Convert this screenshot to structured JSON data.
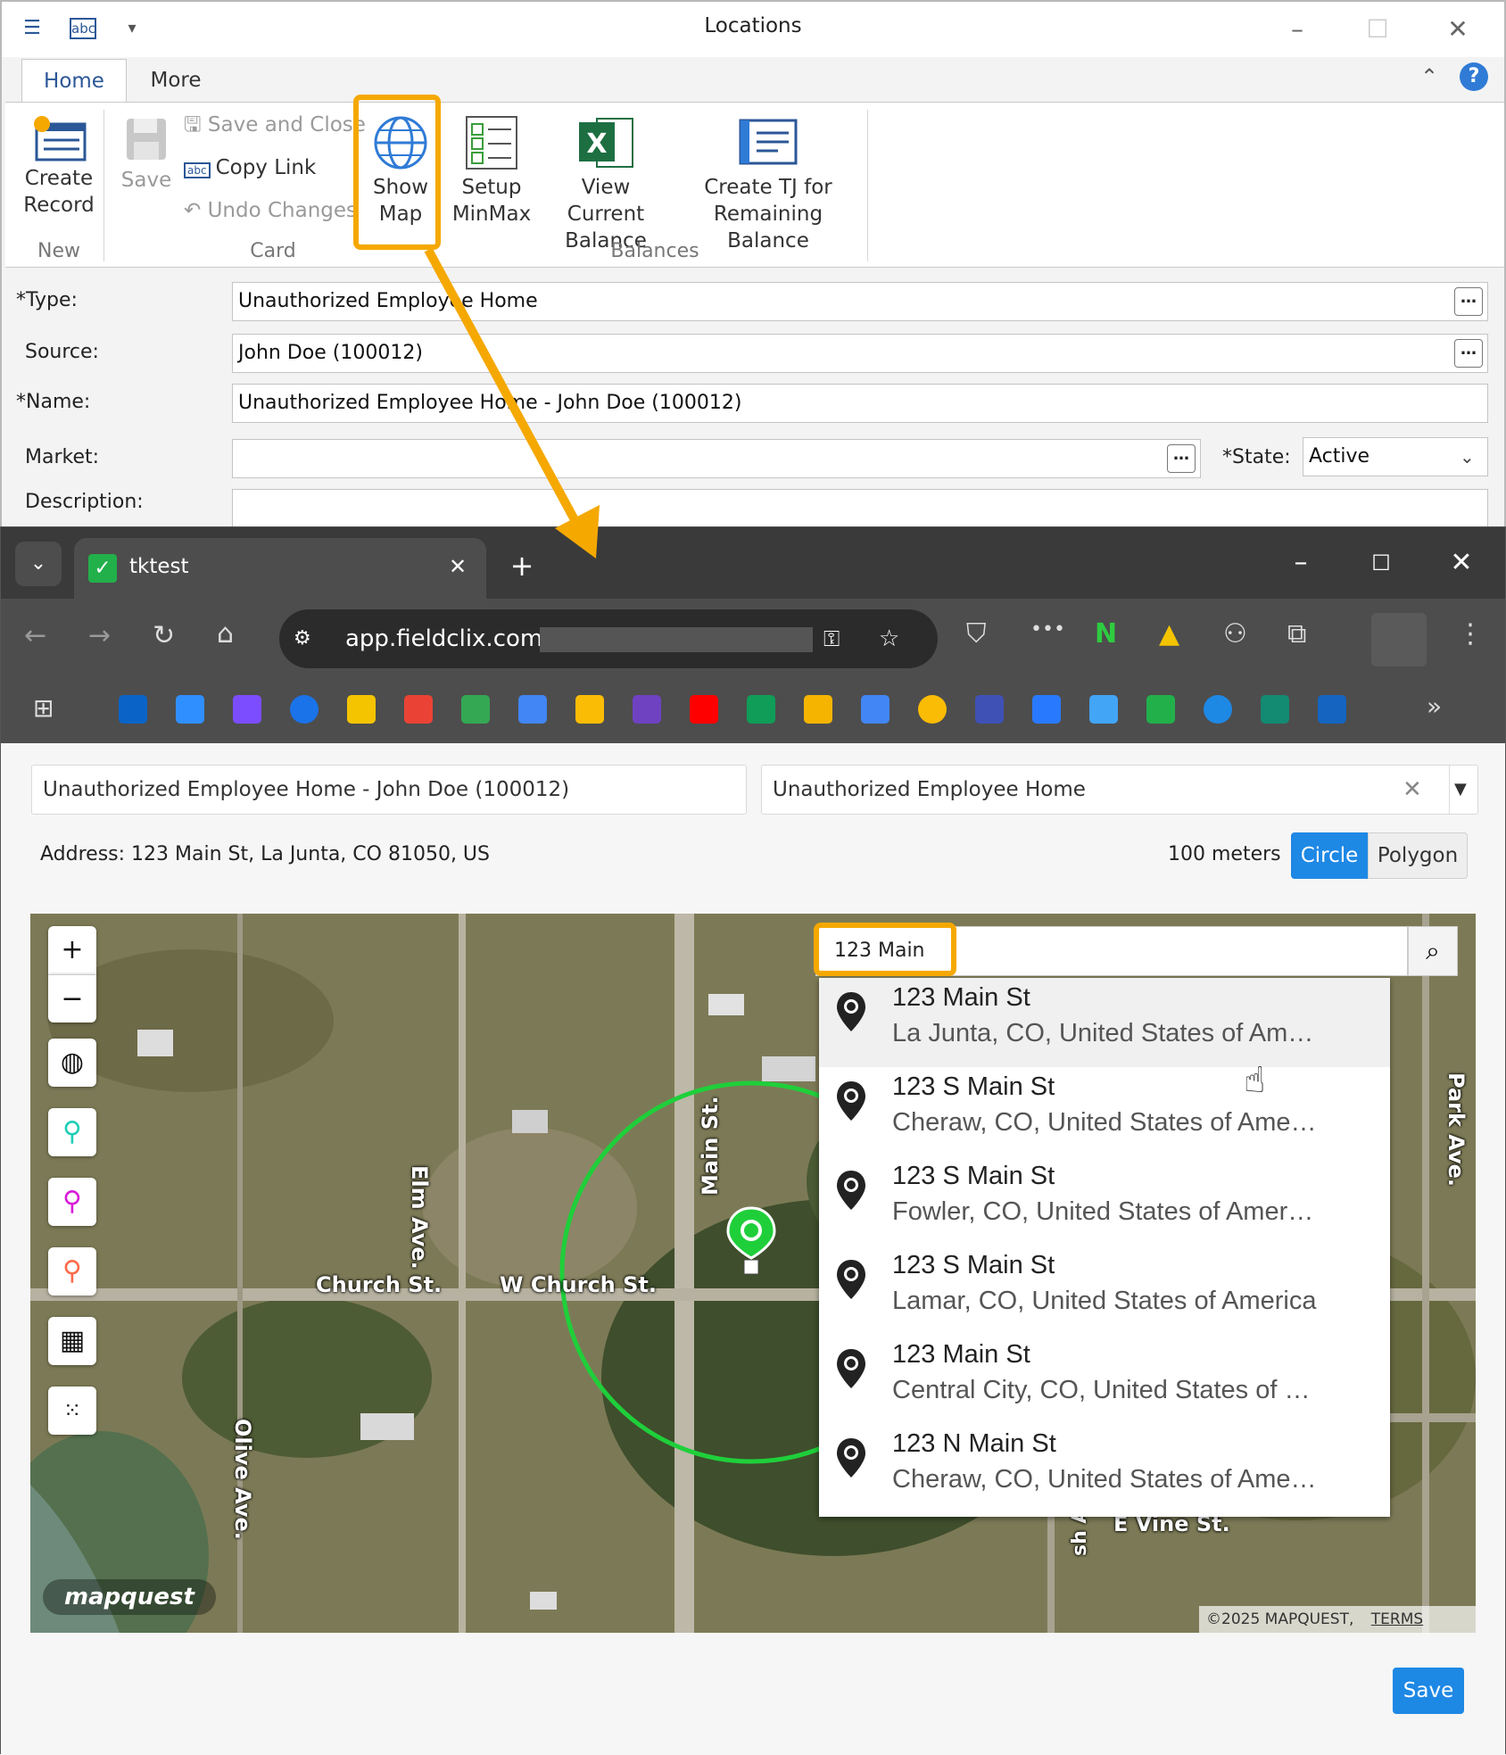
{
  "window": {
    "title": "Locations"
  },
  "ribbon": {
    "tabs": [
      "Home",
      "More"
    ],
    "create_record": "Create\nRecord",
    "create_record_l1": "Create",
    "create_record_l2": "Record",
    "save": "Save",
    "save_and_close": "Save and Close",
    "copy_link": "Copy Link",
    "undo_changes": "Undo Changes",
    "show_map_l1": "Show",
    "show_map_l2": "Map",
    "setup_l1": "Setup",
    "setup_l2": "MinMax",
    "view_l1": "View Current",
    "view_l2": "Balance",
    "tj_l1": "Create TJ for",
    "tj_l2": "Remaining Balance",
    "groups": {
      "new": "New",
      "card": "Card",
      "balances": "Balances"
    }
  },
  "form": {
    "type_label": "*Type:",
    "type_value": "Unauthorized Employee Home",
    "source_label": "Source:",
    "source_value": "John Doe (100012)",
    "name_label": "*Name:",
    "name_value": "Unauthorized Employee Home - John Doe (100012)",
    "market_label": "Market:",
    "market_value": "",
    "state_label": "*State:",
    "state_value": "Active",
    "description_label": "Description:"
  },
  "browser": {
    "tab_title": "tktest",
    "url": "app.fieldclix.com/"
  },
  "page": {
    "name_input": "Unauthorized Employee Home - John Doe (100012)",
    "type_select": "Unauthorized Employee Home",
    "address": "Address: 123 Main St, La Junta, CO 81050, US",
    "radius": "100 meters",
    "shape_options": [
      "Circle",
      "Polygon"
    ],
    "save_label": "Save"
  },
  "map": {
    "search_value": "123 Main",
    "results": [
      {
        "street": "123 Main St",
        "place": "La Junta, CO, United States of Am…"
      },
      {
        "street": "123 S Main St",
        "place": "Cheraw, CO, United States of Ame…"
      },
      {
        "street": "123 S Main St",
        "place": "Fowler, CO, United States of Amer…"
      },
      {
        "street": "123 S Main St",
        "place": "Lamar, CO, United States of America"
      },
      {
        "street": "123 Main St",
        "place": "Central City, CO, United States of …"
      },
      {
        "street": "123 N Main St",
        "place": "Cheraw, CO, United States of Ame…"
      }
    ],
    "streets": {
      "church": "Church St.",
      "wchurch": "W Church St.",
      "elm": "Elm Ave.",
      "main": "Main St.",
      "olive": "Olive Ave.",
      "park": "Park Ave.",
      "vine": "E Vine St.",
      "ash": "sh Ave."
    },
    "logo": "mapquest",
    "copyright": "©2025 MAPQUEST,",
    "terms": "TERMS"
  },
  "colors": {
    "accent": "#1e88e5",
    "highlight": "#f5a800",
    "circle": "#1fcf3a"
  }
}
